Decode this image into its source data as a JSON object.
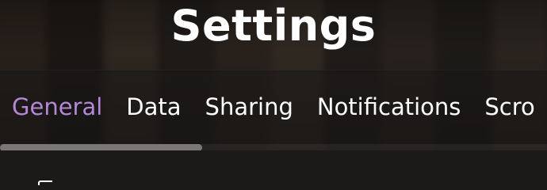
{
  "header": {
    "title": "Settings"
  },
  "tabs": [
    {
      "label": "General",
      "active": true
    },
    {
      "label": "Data",
      "active": false
    },
    {
      "label": "Sharing",
      "active": false
    },
    {
      "label": "Notifications",
      "active": false
    },
    {
      "label": "Scro",
      "active": false
    }
  ],
  "tab_scroll": {
    "position_fraction": 0.0,
    "visible_fraction": 0.37
  },
  "colors": {
    "accent": "#b488d6",
    "background": "#1b1a19",
    "text": "#ffffff",
    "scrollbar_thumb": "#7a7776"
  }
}
